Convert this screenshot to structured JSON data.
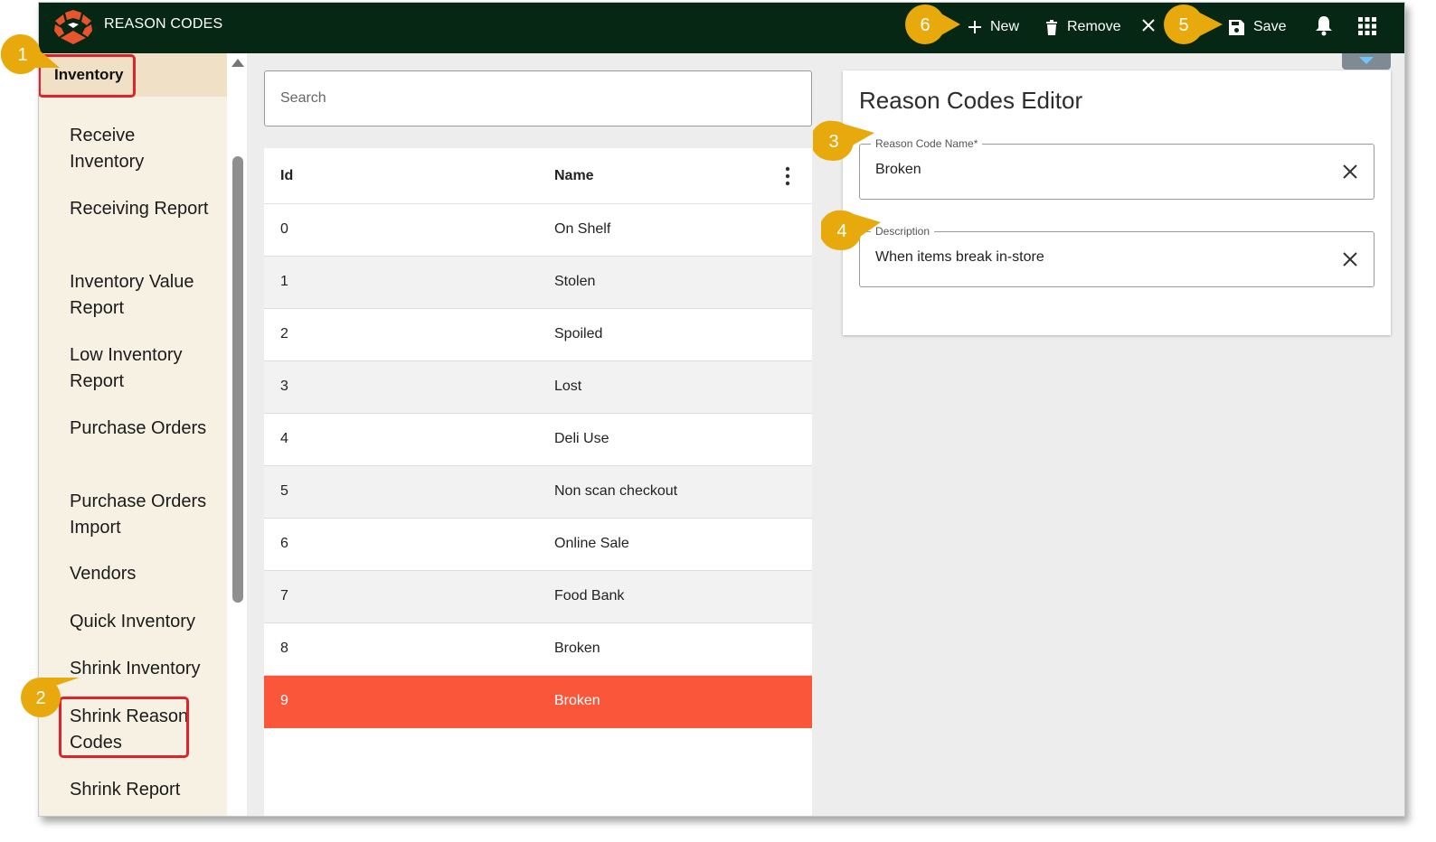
{
  "app": {
    "title": "REASON CODES",
    "brand_color": "#e8542c",
    "topbar_color": "#062714"
  },
  "toolbar": {
    "new_label": "New",
    "remove_label": "Remove",
    "save_label": "Save"
  },
  "sidebar": {
    "section": "Inventory",
    "items": [
      {
        "label": "Receive Inventory"
      },
      {
        "label": "Receiving Report"
      },
      {
        "label": "Inventory Value Report"
      },
      {
        "label": "Low Inventory Report"
      },
      {
        "label": "Purchase Orders"
      },
      {
        "label": "Purchase Orders Import"
      },
      {
        "label": "Vendors"
      },
      {
        "label": "Quick Inventory"
      },
      {
        "label": "Shrink Inventory"
      },
      {
        "label": "Shrink Reason Codes"
      },
      {
        "label": "Shrink Report"
      }
    ]
  },
  "search": {
    "placeholder": "Search"
  },
  "grid": {
    "columns": [
      "Id",
      "Name"
    ],
    "rows": [
      {
        "id": "0",
        "name": "On Shelf"
      },
      {
        "id": "1",
        "name": "Stolen"
      },
      {
        "id": "2",
        "name": "Spoiled"
      },
      {
        "id": "3",
        "name": "Lost"
      },
      {
        "id": "4",
        "name": "Deli Use"
      },
      {
        "id": "5",
        "name": "Non scan checkout"
      },
      {
        "id": "6",
        "name": "Online Sale"
      },
      {
        "id": "7",
        "name": "Food Bank"
      },
      {
        "id": "8",
        "name": "Broken"
      },
      {
        "id": "9",
        "name": "Broken"
      }
    ],
    "selected_row": "9",
    "selected_color": "#fa573a"
  },
  "editor": {
    "title": "Reason Codes Editor",
    "name_label": "Reason Code Name*",
    "name_value": "Broken",
    "description_label": "Description",
    "description_value": "When items break in-store"
  },
  "callouts": [
    "1",
    "2",
    "3",
    "4",
    "5",
    "6"
  ],
  "callout_color": "#e8a90c"
}
